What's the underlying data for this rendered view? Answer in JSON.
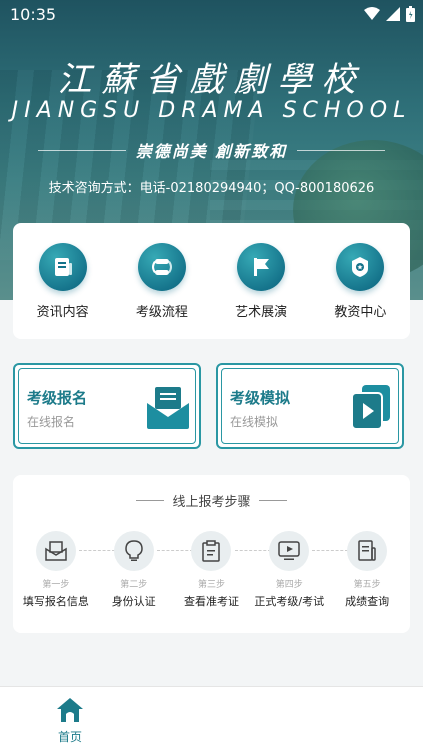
{
  "status_bar": {
    "time": "10:35"
  },
  "header": {
    "school_name_cn": "江蘇省戲劇學校",
    "school_name_en": "JIANGSU DRAMA SCHOOL",
    "motto": "崇德尚美 創新致和",
    "contact": "技术咨询方式：电话-02180294940；QQ-800180626"
  },
  "quick_menu": [
    {
      "label": "资讯内容",
      "icon": "news-icon"
    },
    {
      "label": "考级流程",
      "icon": "process-icon"
    },
    {
      "label": "艺术展演",
      "icon": "flag-icon"
    },
    {
      "label": "教资中心",
      "icon": "badge-icon"
    }
  ],
  "cards": {
    "register": {
      "title": "考级报名",
      "subtitle": "在线报名"
    },
    "mock": {
      "title": "考级模拟",
      "subtitle": "在线模拟"
    }
  },
  "steps": {
    "title": "线上报考步骤",
    "items": [
      {
        "num": "第一步",
        "label": "填写报名信息"
      },
      {
        "num": "第二步",
        "label": "身份认证"
      },
      {
        "num": "第三步",
        "label": "查看准考证"
      },
      {
        "num": "第四步",
        "label": "正式考级/考试"
      },
      {
        "num": "第五步",
        "label": "成绩查询"
      }
    ]
  },
  "tabbar": {
    "home_label": "首页"
  },
  "colors": {
    "accent": "#1d7b8a",
    "icon_bg": "#14728a"
  }
}
